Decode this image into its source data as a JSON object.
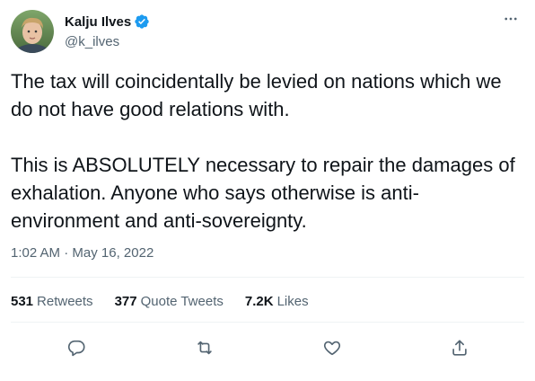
{
  "author": {
    "display_name": "Kalju Ilves",
    "handle": "@k_ilves",
    "verified": true,
    "avatar_icon": "avatar-photo"
  },
  "tweet": {
    "text": "The tax will coincidentally be levied on nations which we do not have good relations with.\n\nThis is ABSOLUTELY necessary to repair the damages of exhalation. Anyone who says otherwise is anti-environment and anti-sovereignty.",
    "time": "1:02 AM",
    "separator": "·",
    "date": "May 16, 2022"
  },
  "stats": {
    "retweets_count": "531",
    "retweets_label": "Retweets",
    "quotes_count": "377",
    "quotes_label": "Quote Tweets",
    "likes_count": "7.2K",
    "likes_label": "Likes"
  },
  "icons": {
    "more": "more-icon",
    "reply": "reply-icon",
    "retweet": "retweet-icon",
    "like": "heart-icon",
    "share": "share-icon",
    "verified": "verified-badge-icon"
  },
  "colors": {
    "text_primary": "#0f1419",
    "text_secondary": "#536471",
    "verified_blue": "#1d9bf0",
    "divider": "#eff3f4"
  }
}
